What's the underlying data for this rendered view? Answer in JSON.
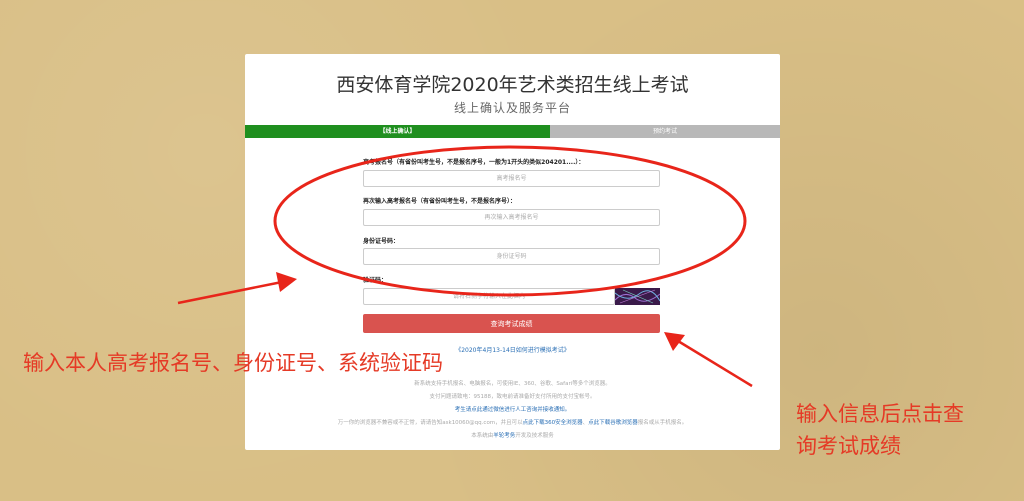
{
  "header": {
    "title": "西安体育学院2020年艺术类招生线上考试",
    "subtitle": "线上确认及服务平台"
  },
  "tabs": [
    {
      "label": "【线上确认】",
      "active": true
    },
    {
      "label": "预约考试",
      "active": false
    }
  ],
  "form": {
    "exam_no": {
      "label": "高考报名号（有省份叫考生号，不是报名序号，一般为1开头的类似204201....）：",
      "placeholder": "高考报名号"
    },
    "exam_no_confirm": {
      "label": "再次输入高考报名号（有省份叫考生号，不是报名序号）：",
      "placeholder": "再次输入高考报名号"
    },
    "id_no": {
      "label": "身份证号码：",
      "placeholder": "身份证号码"
    },
    "captcha": {
      "label": "验证码：",
      "placeholder": "请将右侧字符输入在此框内"
    },
    "submit_label": "查询考试成绩"
  },
  "mock_link": "《2020年4月13-14日如何进行模拟考试》",
  "footer": {
    "line1": "新系统支持手机报名、电脑报名，可使用IE、360、谷歌、Safari等多个浏览器。",
    "line2": "支付问题请致电：95188，致电前请准备好支付所用的支付宝帐号。",
    "line3": "考生请点此通过微信进行人工咨询并接收通知。",
    "line4_a": "万一你的浏览器不兼容或不正常，请请告知ask10060@qq.com，并且可以",
    "line4_b": "点此下载360安全浏览器",
    "line4_c": "、",
    "line4_d": "点此下载谷歌浏览器",
    "line4_e": "报名或从手机报名。",
    "line5_a": "本系统由",
    "line5_b": "羊轮考务",
    "line5_c": "开发及技术服务"
  },
  "annotations": {
    "left": "输入本人高考报名号、身份证号、系统验证码",
    "right_line1": "输入信息后点击查",
    "right_line2": "询考试成绩"
  },
  "colors": {
    "background": "#d9bf86",
    "active_tab": "#1f8f1f",
    "inactive_tab": "#b8b8b8",
    "submit": "#d9534f",
    "annotation": "#e53a26",
    "link": "#2a6fb5"
  }
}
